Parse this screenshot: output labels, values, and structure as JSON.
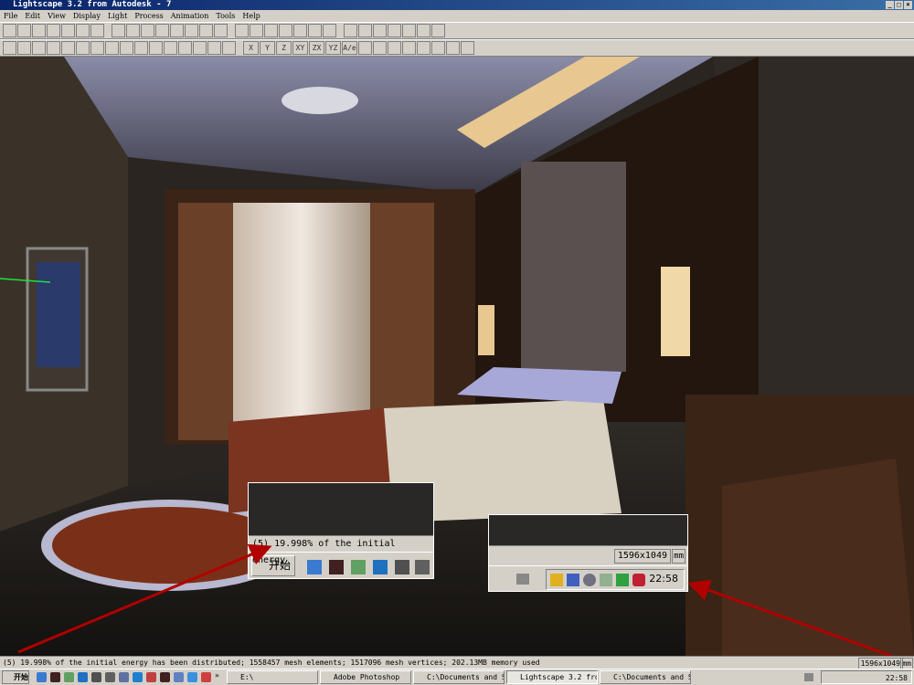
{
  "window": {
    "title": "Lightscape 3.2 from Autodesk - 7"
  },
  "menu": [
    "File",
    "Edit",
    "View",
    "Display",
    "Light",
    "Process",
    "Animation",
    "Tools",
    "Help"
  ],
  "toolbar": {
    "axis_buttons": [
      "X",
      "Y",
      "Z",
      "XY",
      "ZX",
      "YZ",
      "A/e"
    ]
  },
  "status": {
    "message": "(5) 19.998% of the initial energy has been distributed; 1558457 mesh elements; 1517096 mesh vertices; 202.13MB memory used",
    "resolution": "1596x1049",
    "unit": "mm"
  },
  "taskbar": {
    "start": "开始",
    "tasks": [
      "E:\\",
      "Adobe Photoshop",
      "C:\\Documents and Se...",
      "Lightscape 3.2 from...",
      "C:\\Documents and Se..."
    ],
    "clock": "22:58",
    "more": "»"
  },
  "inset_left": {
    "status": "(5) 19.998% of the initial energy",
    "start": "开始"
  },
  "inset_right": {
    "resolution": "1596x1049",
    "unit": "mm",
    "clock": "22:58"
  },
  "colors": {
    "title_bar": "#0a246a",
    "annotation_arrow": "#b00000"
  }
}
